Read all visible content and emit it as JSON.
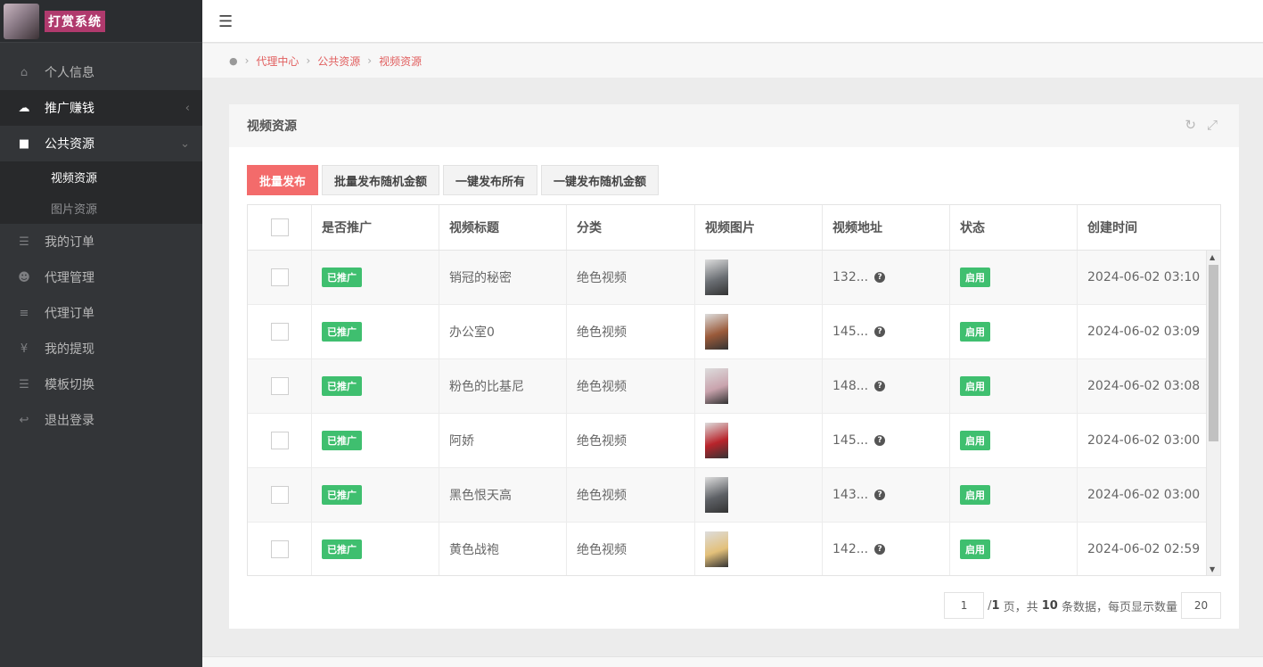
{
  "logo": {
    "text": "打赏系统"
  },
  "sidebar": {
    "items": [
      {
        "label": "个人信息",
        "icon": "home-icon",
        "glyph": "⌂"
      },
      {
        "label": "推广赚钱",
        "icon": "cloud-icon",
        "glyph": "☁"
      },
      {
        "label": "公共资源",
        "icon": "video-camera-icon",
        "glyph": "■"
      },
      {
        "label": "我的订单",
        "icon": "list-icon",
        "glyph": "☰"
      },
      {
        "label": "代理管理",
        "icon": "users-icon",
        "glyph": "☻"
      },
      {
        "label": "代理订单",
        "icon": "bars-icon",
        "glyph": "≡"
      },
      {
        "label": "我的提现",
        "icon": "yen-icon",
        "glyph": "¥"
      },
      {
        "label": "模板切换",
        "icon": "list-icon",
        "glyph": "☰"
      },
      {
        "label": "退出登录",
        "icon": "reply-icon",
        "glyph": "↩"
      }
    ],
    "submenu": [
      {
        "label": "视频资源"
      },
      {
        "label": "图片资源"
      }
    ]
  },
  "breadcrumb": [
    "代理中心",
    "公共资源",
    "视频资源"
  ],
  "panel": {
    "title": "视频资源",
    "buttons": [
      "批量发布",
      "批量发布随机金额",
      "一键发布所有",
      "一键发布随机金额"
    ]
  },
  "table": {
    "headers": [
      "是否推广",
      "视频标题",
      "分类",
      "视频图片",
      "视频地址",
      "状态",
      "创建时间"
    ],
    "rows": [
      {
        "promoted": "已推广",
        "title": "销冠的秘密",
        "category": "绝色视频",
        "url": "132...",
        "status": "启用",
        "created": "2024-06-02 03:10",
        "thumb_color": "#6b6f74"
      },
      {
        "promoted": "已推广",
        "title": "办公室0",
        "category": "绝色视频",
        "url": "145...",
        "status": "启用",
        "created": "2024-06-02 03:09",
        "thumb_color": "#9a5a3a"
      },
      {
        "promoted": "已推广",
        "title": "粉色的比基尼",
        "category": "绝色视频",
        "url": "148...",
        "status": "启用",
        "created": "2024-06-02 03:08",
        "thumb_color": "#c9a3ad"
      },
      {
        "promoted": "已推广",
        "title": "阿娇",
        "category": "绝色视频",
        "url": "145...",
        "status": "启用",
        "created": "2024-06-02 03:00",
        "thumb_color": "#b8242b"
      },
      {
        "promoted": "已推广",
        "title": "黑色恨天高",
        "category": "绝色视频",
        "url": "143...",
        "status": "启用",
        "created": "2024-06-02 03:00",
        "thumb_color": "#5e6166"
      },
      {
        "promoted": "已推广",
        "title": "黄色战袍",
        "category": "绝色视频",
        "url": "142...",
        "status": "启用",
        "created": "2024-06-02 02:59",
        "thumb_color": "#e3c07a"
      }
    ]
  },
  "pager": {
    "current_page": "1",
    "text_slash": "/ ",
    "total_pages": "1",
    "text_page_total": " 页，共 ",
    "total_records": "10",
    "text_records_per": " 条数据，每页显示数量",
    "page_size": "20"
  }
}
